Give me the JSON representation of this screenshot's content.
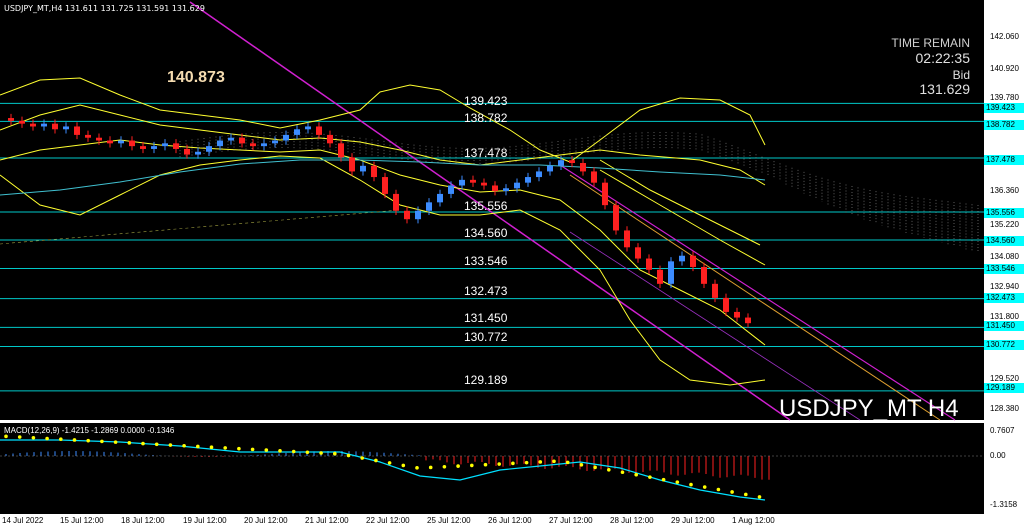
{
  "chart": {
    "symbol_info": "USDJPY_MT,H4  131.611 131.725 131.591 131.629",
    "session_high": "140.873",
    "symbol_watermark": "USDJPY_MT H4",
    "time_remain_label": "TIME REMAIN",
    "time_remain": "02:22:35",
    "bid_label": "Bid",
    "bid_value": "131.629",
    "level_labels": [
      "139.423",
      "138.782",
      "137.478",
      "135.556",
      "134.560",
      "133.546",
      "132.473",
      "131.450",
      "130.772",
      "129.189"
    ],
    "price_tags": [
      "139.423",
      "138.782",
      "137.478",
      "135.556",
      "134.560",
      "133.546",
      "132.473",
      "131.450",
      "130.772",
      "129.189"
    ],
    "price_axis": [
      "142.060",
      "140.920",
      "139.780",
      "136.360",
      "135.220",
      "134.080",
      "132.940",
      "131.800",
      "129.520",
      "128.380"
    ],
    "macd_info": "MACD(12,26,9) -1.4215 -1.2869 0.0000 -0.1346",
    "macd_axis": [
      "0.7607",
      "0.00",
      "-1.3158"
    ],
    "time_axis": [
      "14 Jul 2022",
      "15 Jul 12:00",
      "18 Jul 12:00",
      "19 Jul 12:00",
      "20 Jul 12:00",
      "21 Jul 12:00",
      "22 Jul 12:00",
      "25 Jul 12:00",
      "26 Jul 12:00",
      "27 Jul 12:00",
      "28 Jul 12:00",
      "29 Jul 12:00",
      "1 Aug 12:00"
    ],
    "colors": {
      "background": "#000000",
      "bull_candle": "#3c8cff",
      "bear_candle": "#ff2020",
      "level_line": "#00c8c8",
      "bands": "#ffff30",
      "channel": "#d020d0",
      "signal_dots": "#ffff00",
      "macd_line": "#00e0ff"
    }
  }
}
